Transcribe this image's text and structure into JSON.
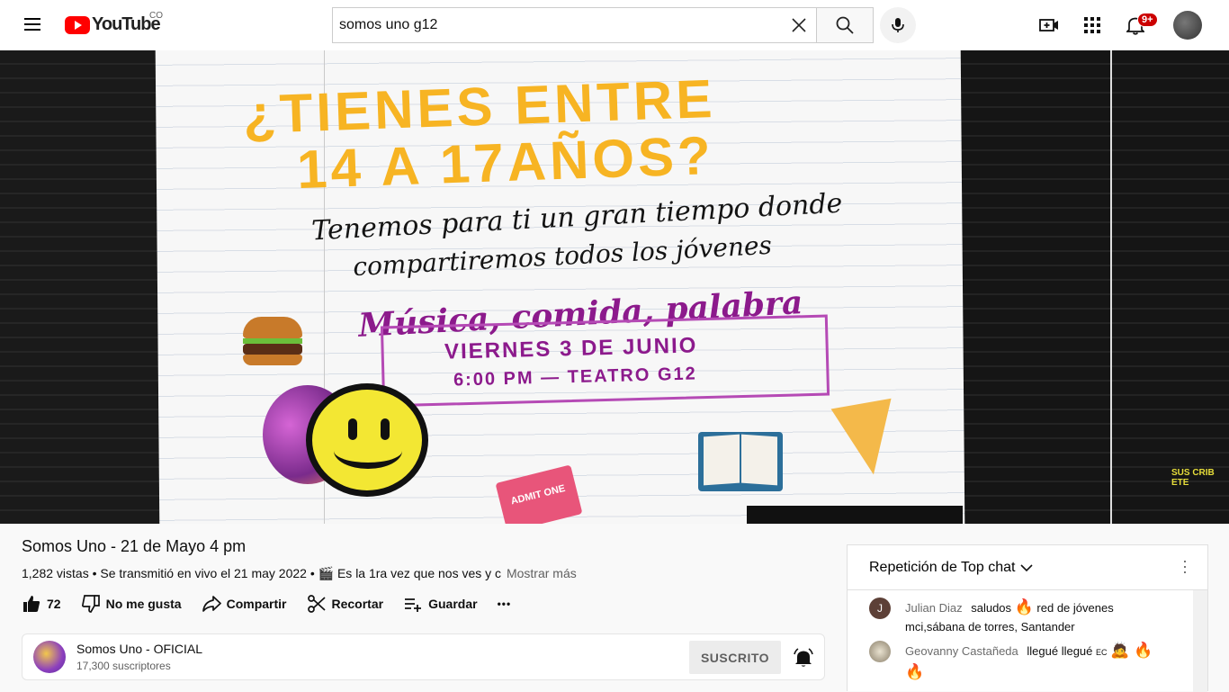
{
  "header": {
    "logo_text": "YouTube",
    "country_code": "CO",
    "search_value": "somos uno g12",
    "notifications_badge": "9+"
  },
  "video_frame": {
    "headline_line1": "¿TIENES ENTRE",
    "headline_line2": "14 A 17AÑOS?",
    "subtitle_line1": "Tenemos para ti un gran tiempo donde",
    "subtitle_line2": "compartiremos todos los jóvenes",
    "highlight": "Música, comida, palabra",
    "date": "VIERNES 3 DE JUNIO",
    "time_place": "6:00 PM — TEATRO G12",
    "ticket_text": "ADMIT ONE",
    "corner_badge": "SUS CRIB ETE"
  },
  "video": {
    "title": "Somos Uno - 21 de Mayo 4 pm",
    "meta": "1,282 vistas • Se transmitió en vivo el 21 may 2022 • ",
    "desc_snippet": "🎬 Es la 1ra vez que nos ves y c",
    "more_label": "Mostrar más"
  },
  "actions": {
    "like_count": "72",
    "dislike_label": "No me gusta",
    "share_label": "Compartir",
    "clip_label": "Recortar",
    "save_label": "Guardar",
    "more_label": "•••"
  },
  "channel": {
    "name": "Somos Uno - OFICIAL",
    "subscribers": "17,300 suscriptores",
    "subscribed_label": "SUSCRITO"
  },
  "chat": {
    "header": "Repetición de Top chat",
    "messages": [
      {
        "initial": "J",
        "author": "Julian Diaz",
        "text_before": "saludos ",
        "emoji": "🔥",
        "text_after": " red de jóvenes mci,sábana de torres, Santander"
      },
      {
        "initial": "",
        "author": "Geovanny Castañeda",
        "text_before": "llegué llegué ",
        "badge": "EC",
        "emoji": "🙇 🔥 🔥",
        "text_after": ""
      }
    ]
  }
}
